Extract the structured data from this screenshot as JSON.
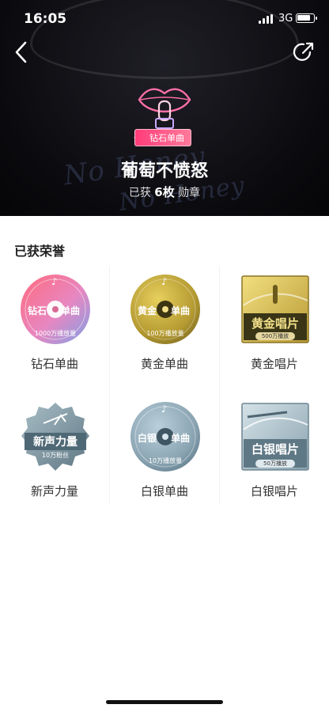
{
  "status_bar": {
    "time": "16:05",
    "network": "3G"
  },
  "header": {
    "neon_text_1": "No Honey",
    "neon_text_2": "No Honey",
    "badge_tag": "钻石单曲",
    "song_title": "葡萄不愤怒",
    "earned_prefix": "已获",
    "earned_count": "6枚",
    "earned_suffix": "勋章"
  },
  "section": {
    "title": "已获荣誉"
  },
  "medals": [
    {
      "label": "钻石单曲",
      "left_text": "钻石",
      "right_text": "单曲",
      "caption": "1000万播放量",
      "type": "disc",
      "color_a": "#f26f86",
      "color_b": "#a78bd8"
    },
    {
      "label": "黄金单曲",
      "left_text": "黄金",
      "right_text": "单曲",
      "caption": "100万播放量",
      "type": "disc",
      "color_a": "#d7bb42",
      "color_b": "#8c7b2a"
    },
    {
      "label": "黄金唱片",
      "title_text": "黄金唱片",
      "caption": "500万播放",
      "type": "record",
      "color_a": "#d4b64a",
      "color_b": "#f1de7a"
    },
    {
      "label": "新声力量",
      "title_text": "新声力量",
      "caption": "10万粉丝",
      "type": "star",
      "color_a": "#6c8692",
      "color_b": "#9fb4bd"
    },
    {
      "label": "白银单曲",
      "left_text": "白银",
      "right_text": "单曲",
      "caption": "10万播放量",
      "type": "disc",
      "color_a": "#9db6c4",
      "color_b": "#6b8797"
    },
    {
      "label": "白银唱片",
      "title_text": "白银唱片",
      "caption": "50万播放",
      "type": "record",
      "color_a": "#8ea8b4",
      "color_b": "#c9d8df"
    }
  ]
}
